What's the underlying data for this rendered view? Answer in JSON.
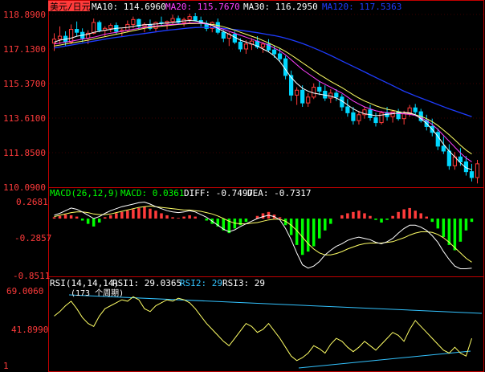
{
  "main_panel": {
    "title": "美元/日元",
    "ma_readouts": [
      {
        "label": "MA10: 114.6960",
        "color": "#ffffff"
      },
      {
        "label": "MA20: 115.7670",
        "color": "#ff40ff"
      },
      {
        "label": "MA30: 116.2950",
        "color": "#ffffff"
      },
      {
        "label": "MA120: 117.5363",
        "color": "#1e3cff"
      }
    ],
    "y_ticks": [
      "118.8900",
      "117.1300",
      "115.3700",
      "113.6100",
      "111.8500",
      "110.0900"
    ]
  },
  "macd_panel": {
    "title": "MACD(26,12,9)",
    "macd_label": "MACD: 0.0361",
    "diff_label": "DIFF: -0.7497",
    "dea_label": "DEA: -0.7317",
    "y_ticks": [
      "0.2681",
      "-0.2857",
      "-0.8511"
    ]
  },
  "rsi_panel": {
    "title": "RSI(14,14,14)",
    "rsi1_label": "RSI1: 29.0365",
    "rsi2_label": "RSI2: 29",
    "rsi3_label": "RSI3: 29",
    "annotation": "(173 个周期)",
    "y_ticks": [
      "69.0060",
      "41.8990"
    ],
    "bottom_left_tick": "1"
  },
  "colors": {
    "up": "#ff3b3b",
    "down": "#00d7ff",
    "grid_border": "#c00000",
    "ma_white": "#ffffff",
    "ma_magenta": "#ff40ff",
    "ma_yellow": "#ffff66",
    "ma120_blue": "#1e3cff",
    "macd_green": "#00ff00",
    "macd_red": "#ff3b3b",
    "rsi_yellow": "#ffff66",
    "trend_cyan": "#33c3ff"
  },
  "chart_data": {
    "type": "candlestick",
    "ylim": [
      110.09,
      118.89
    ],
    "candles": [
      [
        117.35,
        117.85,
        116.95,
        117.55
      ],
      [
        117.55,
        118.2,
        117.3,
        117.7
      ],
      [
        117.7,
        117.95,
        117.2,
        117.4
      ],
      [
        117.4,
        118.3,
        117.3,
        118.05
      ],
      [
        118.05,
        118.45,
        117.7,
        117.9
      ],
      [
        117.9,
        118.1,
        117.4,
        117.6
      ],
      [
        117.6,
        118.0,
        117.3,
        117.85
      ],
      [
        117.85,
        118.6,
        117.8,
        118.4
      ],
      [
        118.4,
        118.5,
        117.9,
        118.0
      ],
      [
        118.0,
        118.2,
        117.7,
        118.1
      ],
      [
        118.1,
        118.35,
        117.9,
        118.25
      ],
      [
        118.25,
        118.4,
        117.8,
        117.95
      ],
      [
        117.95,
        118.1,
        117.7,
        118.0
      ],
      [
        118.0,
        118.5,
        117.9,
        118.3
      ],
      [
        118.3,
        118.7,
        118.1,
        118.55
      ],
      [
        118.55,
        118.6,
        118.05,
        118.2
      ],
      [
        118.2,
        118.4,
        117.9,
        118.3
      ],
      [
        118.3,
        118.55,
        118.0,
        118.1
      ],
      [
        118.1,
        118.45,
        117.95,
        118.4
      ],
      [
        118.4,
        118.7,
        118.2,
        118.35
      ],
      [
        118.35,
        118.5,
        118.05,
        118.45
      ],
      [
        118.45,
        118.8,
        118.3,
        118.6
      ],
      [
        118.6,
        118.75,
        118.3,
        118.4
      ],
      [
        118.4,
        118.65,
        118.2,
        118.55
      ],
      [
        118.55,
        118.85,
        118.4,
        118.7
      ],
      [
        118.7,
        118.89,
        118.45,
        118.5
      ],
      [
        118.5,
        118.7,
        118.2,
        118.35
      ],
      [
        118.35,
        118.5,
        117.95,
        118.1
      ],
      [
        118.1,
        118.45,
        117.9,
        118.4
      ],
      [
        118.4,
        118.6,
        117.8,
        117.9
      ],
      [
        117.9,
        118.0,
        117.4,
        117.6
      ],
      [
        117.6,
        117.9,
        117.2,
        117.8
      ],
      [
        117.8,
        117.95,
        117.3,
        117.4
      ],
      [
        117.4,
        117.6,
        116.9,
        117.05
      ],
      [
        117.05,
        117.5,
        116.8,
        117.3
      ],
      [
        117.3,
        117.6,
        117.0,
        117.45
      ],
      [
        117.45,
        117.7,
        117.05,
        117.15
      ],
      [
        117.15,
        117.4,
        116.85,
        117.3
      ],
      [
        117.3,
        117.55,
        116.9,
        117.0
      ],
      [
        117.0,
        117.2,
        116.6,
        116.8
      ],
      [
        116.8,
        117.1,
        116.4,
        116.55
      ],
      [
        116.55,
        116.7,
        115.5,
        115.7
      ],
      [
        115.7,
        115.95,
        114.4,
        114.7
      ],
      [
        114.7,
        115.1,
        114.2,
        114.95
      ],
      [
        114.95,
        115.2,
        114.1,
        114.3
      ],
      [
        114.3,
        114.8,
        114.1,
        114.6
      ],
      [
        114.6,
        115.3,
        114.5,
        115.1
      ],
      [
        115.1,
        115.4,
        114.7,
        114.9
      ],
      [
        114.9,
        115.2,
        114.4,
        114.55
      ],
      [
        114.55,
        115.0,
        114.3,
        114.8
      ],
      [
        114.8,
        115.0,
        114.4,
        114.6
      ],
      [
        114.6,
        114.75,
        113.9,
        114.1
      ],
      [
        114.1,
        114.5,
        113.6,
        113.8
      ],
      [
        113.8,
        114.1,
        113.2,
        113.4
      ],
      [
        113.4,
        113.9,
        113.2,
        113.7
      ],
      [
        113.7,
        114.1,
        113.5,
        113.95
      ],
      [
        113.95,
        114.2,
        113.4,
        113.55
      ],
      [
        113.55,
        113.8,
        113.1,
        113.3
      ],
      [
        113.3,
        113.9,
        113.2,
        113.8
      ],
      [
        113.8,
        114.1,
        113.4,
        113.6
      ],
      [
        113.6,
        113.95,
        113.3,
        113.85
      ],
      [
        113.85,
        114.0,
        113.4,
        113.5
      ],
      [
        113.5,
        113.9,
        113.2,
        113.75
      ],
      [
        113.75,
        114.2,
        113.6,
        114.05
      ],
      [
        114.05,
        114.25,
        113.7,
        113.85
      ],
      [
        113.85,
        114.0,
        113.3,
        113.4
      ],
      [
        113.4,
        113.7,
        112.9,
        113.1
      ],
      [
        113.1,
        113.5,
        112.6,
        112.8
      ],
      [
        112.8,
        113.0,
        111.9,
        112.1
      ],
      [
        112.1,
        112.6,
        111.7,
        111.85
      ],
      [
        111.85,
        112.2,
        110.9,
        111.1
      ],
      [
        111.1,
        111.8,
        110.9,
        111.55
      ],
      [
        111.55,
        112.0,
        111.1,
        111.3
      ],
      [
        111.3,
        111.6,
        110.6,
        110.8
      ],
      [
        110.8,
        111.2,
        110.3,
        110.5
      ],
      [
        110.5,
        111.4,
        110.2,
        111.2
      ]
    ],
    "ma10": [
      117.4,
      117.5,
      117.55,
      117.6,
      117.7,
      117.75,
      117.8,
      117.9,
      117.95,
      118.0,
      118.05,
      118.1,
      118.12,
      118.15,
      118.2,
      118.25,
      118.28,
      118.3,
      118.32,
      118.35,
      118.38,
      118.4,
      118.45,
      118.48,
      118.5,
      118.48,
      118.42,
      118.35,
      118.25,
      118.1,
      117.95,
      117.8,
      117.65,
      117.5,
      117.4,
      117.3,
      117.2,
      117.05,
      116.9,
      116.7,
      116.4,
      116.0,
      115.6,
      115.3,
      115.05,
      114.9,
      114.8,
      114.75,
      114.7,
      114.65,
      114.55,
      114.4,
      114.2,
      114.0,
      113.85,
      113.75,
      113.7,
      113.65,
      113.68,
      113.72,
      113.75,
      113.8,
      113.82,
      113.8,
      113.7,
      113.5,
      113.25,
      112.95,
      112.6,
      112.2,
      111.85,
      111.55,
      111.25,
      111.0,
      110.9
    ],
    "ma20": [
      117.3,
      117.35,
      117.4,
      117.45,
      117.5,
      117.55,
      117.6,
      117.65,
      117.72,
      117.8,
      117.85,
      117.9,
      117.95,
      118.0,
      118.05,
      118.1,
      118.15,
      118.2,
      118.22,
      118.25,
      118.28,
      118.3,
      118.32,
      118.35,
      118.38,
      118.38,
      118.36,
      118.32,
      118.25,
      118.15,
      118.05,
      117.95,
      117.85,
      117.75,
      117.65,
      117.55,
      117.45,
      117.35,
      117.25,
      117.1,
      116.95,
      116.75,
      116.5,
      116.25,
      116.0,
      115.8,
      115.6,
      115.4,
      115.25,
      115.1,
      114.95,
      114.8,
      114.6,
      114.4,
      114.25,
      114.1,
      114.0,
      113.9,
      113.85,
      113.8,
      113.78,
      113.76,
      113.74,
      113.72,
      113.66,
      113.55,
      113.4,
      113.2,
      112.95,
      112.65,
      112.35,
      112.05,
      111.75,
      111.5,
      111.3
    ],
    "ma30": [
      117.2,
      117.25,
      117.3,
      117.35,
      117.4,
      117.45,
      117.5,
      117.56,
      117.62,
      117.68,
      117.74,
      117.8,
      117.86,
      117.92,
      117.98,
      118.04,
      118.1,
      118.15,
      118.18,
      118.21,
      118.24,
      118.27,
      118.3,
      118.32,
      118.34,
      118.35,
      118.35,
      118.33,
      118.3,
      118.25,
      118.18,
      118.1,
      118.0,
      117.9,
      117.8,
      117.7,
      117.6,
      117.48,
      117.36,
      117.22,
      117.08,
      116.92,
      116.74,
      116.55,
      116.35,
      116.15,
      115.95,
      115.75,
      115.58,
      115.4,
      115.24,
      115.08,
      114.9,
      114.72,
      114.55,
      114.4,
      114.28,
      114.16,
      114.06,
      113.98,
      113.92,
      113.86,
      113.8,
      113.76,
      113.7,
      113.62,
      113.5,
      113.35,
      113.15,
      112.92,
      112.68,
      112.42,
      112.15,
      111.9,
      111.7
    ],
    "ma120": [
      117.1,
      117.15,
      117.2,
      117.25,
      117.3,
      117.35,
      117.4,
      117.45,
      117.5,
      117.55,
      117.6,
      117.64,
      117.68,
      117.72,
      117.76,
      117.8,
      117.84,
      117.88,
      117.92,
      117.96,
      118.0,
      118.03,
      118.06,
      118.09,
      118.12,
      118.14,
      118.15,
      118.15,
      118.14,
      118.12,
      118.1,
      118.07,
      118.04,
      118.0,
      117.96,
      117.92,
      117.88,
      117.83,
      117.78,
      117.73,
      117.67,
      117.6,
      117.52,
      117.43,
      117.33,
      117.22,
      117.1,
      116.98,
      116.85,
      116.72,
      116.58,
      116.44,
      116.3,
      116.16,
      116.02,
      115.88,
      115.74,
      115.6,
      115.46,
      115.32,
      115.18,
      115.04,
      114.9,
      114.78,
      114.66,
      114.55,
      114.44,
      114.33,
      114.22,
      114.11,
      114.0,
      113.9,
      113.8,
      113.7,
      113.6
    ],
    "macd_ylim": [
      -0.8511,
      0.2681
    ],
    "macd_hist": [
      0.02,
      0.04,
      0.06,
      0.05,
      0.03,
      -0.03,
      -0.08,
      -0.12,
      -0.06,
      0.02,
      0.05,
      0.08,
      0.1,
      0.12,
      0.14,
      0.16,
      0.18,
      0.15,
      0.12,
      0.08,
      0.05,
      0.02,
      0.01,
      0.03,
      0.05,
      0.03,
      0.0,
      -0.03,
      -0.08,
      -0.12,
      -0.18,
      -0.22,
      -0.15,
      -0.1,
      -0.05,
      0.0,
      0.04,
      0.08,
      0.1,
      0.06,
      0.02,
      -0.1,
      -0.25,
      -0.4,
      -0.55,
      -0.5,
      -0.42,
      -0.3,
      -0.18,
      -0.08,
      0.0,
      0.05,
      0.08,
      0.1,
      0.12,
      0.08,
      0.04,
      -0.02,
      -0.06,
      -0.02,
      0.04,
      0.1,
      0.14,
      0.16,
      0.12,
      0.08,
      0.03,
      -0.05,
      -0.15,
      -0.28,
      -0.4,
      -0.48,
      -0.35,
      -0.18,
      -0.05
    ],
    "macd_diff": [
      0.05,
      0.08,
      0.12,
      0.16,
      0.14,
      0.1,
      0.05,
      0.0,
      0.03,
      0.08,
      0.12,
      0.15,
      0.18,
      0.2,
      0.22,
      0.24,
      0.25,
      0.22,
      0.18,
      0.15,
      0.12,
      0.1,
      0.09,
      0.1,
      0.12,
      0.1,
      0.06,
      0.02,
      -0.04,
      -0.1,
      -0.16,
      -0.2,
      -0.17,
      -0.12,
      -0.08,
      -0.04,
      0.0,
      0.03,
      0.05,
      0.03,
      -0.02,
      -0.15,
      -0.32,
      -0.52,
      -0.7,
      -0.75,
      -0.72,
      -0.65,
      -0.55,
      -0.48,
      -0.42,
      -0.38,
      -0.33,
      -0.3,
      -0.28,
      -0.3,
      -0.32,
      -0.36,
      -0.38,
      -0.35,
      -0.3,
      -0.22,
      -0.15,
      -0.1,
      -0.1,
      -0.13,
      -0.18,
      -0.26,
      -0.36,
      -0.5,
      -0.62,
      -0.72,
      -0.76,
      -0.76,
      -0.75
    ],
    "macd_dea": [
      0.03,
      0.05,
      0.07,
      0.09,
      0.1,
      0.1,
      0.09,
      0.07,
      0.06,
      0.06,
      0.07,
      0.09,
      0.11,
      0.13,
      0.15,
      0.17,
      0.18,
      0.19,
      0.18,
      0.17,
      0.16,
      0.15,
      0.14,
      0.13,
      0.13,
      0.12,
      0.11,
      0.09,
      0.07,
      0.04,
      0.0,
      -0.04,
      -0.07,
      -0.08,
      -0.08,
      -0.07,
      -0.06,
      -0.04,
      -0.02,
      -0.01,
      -0.01,
      -0.04,
      -0.1,
      -0.18,
      -0.28,
      -0.38,
      -0.46,
      -0.52,
      -0.55,
      -0.55,
      -0.53,
      -0.5,
      -0.46,
      -0.43,
      -0.4,
      -0.38,
      -0.37,
      -0.37,
      -0.37,
      -0.36,
      -0.35,
      -0.32,
      -0.29,
      -0.25,
      -0.22,
      -0.2,
      -0.2,
      -0.21,
      -0.24,
      -0.29,
      -0.36,
      -0.44,
      -0.52,
      -0.6,
      -0.66
    ],
    "rsi_ylim": [
      20,
      72
    ],
    "rsi": [
      55,
      58,
      62,
      65,
      60,
      54,
      50,
      48,
      55,
      60,
      62,
      64,
      66,
      65,
      68,
      66,
      60,
      58,
      62,
      64,
      66,
      65,
      67,
      66,
      64,
      60,
      55,
      50,
      46,
      42,
      38,
      35,
      40,
      45,
      50,
      48,
      44,
      46,
      50,
      45,
      40,
      34,
      28,
      25,
      27,
      30,
      35,
      33,
      30,
      36,
      40,
      38,
      34,
      31,
      34,
      38,
      35,
      32,
      36,
      40,
      44,
      42,
      38,
      46,
      52,
      48,
      44,
      40,
      36,
      32,
      30,
      34,
      30,
      28,
      40
    ]
  }
}
